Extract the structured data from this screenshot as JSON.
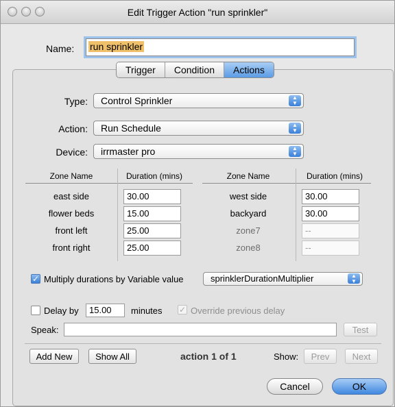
{
  "window": {
    "title": "Edit Trigger Action \"run sprinkler\""
  },
  "name_field": {
    "label": "Name:",
    "value": "run sprinkler"
  },
  "tabs": [
    {
      "label": "Trigger",
      "active": false
    },
    {
      "label": "Condition",
      "active": false
    },
    {
      "label": "Actions",
      "active": true
    }
  ],
  "type_row": {
    "label": "Type:",
    "value": "Control Sprinkler"
  },
  "action_row": {
    "label": "Action:",
    "value": "Run Schedule"
  },
  "device_row": {
    "label": "Device:",
    "value": "irrmaster pro"
  },
  "zones": {
    "headers": {
      "zone_name": "Zone Name",
      "duration": "Duration (mins)"
    },
    "left": [
      {
        "name": "east side",
        "duration": "30.00",
        "enabled": true
      },
      {
        "name": "flower beds",
        "duration": "15.00",
        "enabled": true
      },
      {
        "name": "front left",
        "duration": "25.00",
        "enabled": true
      },
      {
        "name": "front right",
        "duration": "25.00",
        "enabled": true
      }
    ],
    "right": [
      {
        "name": "west side",
        "duration": "30.00",
        "enabled": true
      },
      {
        "name": "backyard",
        "duration": "30.00",
        "enabled": true
      },
      {
        "name": "zone7",
        "duration": "--",
        "enabled": false
      },
      {
        "name": "zone8",
        "duration": "--",
        "enabled": false
      }
    ]
  },
  "multiply": {
    "checked": true,
    "label": "Multiply durations by Variable value",
    "variable": "sprinklerDurationMultiplier"
  },
  "delay": {
    "checked": false,
    "label": "Delay by",
    "value": "15.00",
    "unit": "minutes",
    "override_label": "Override previous delay",
    "override_checked": true
  },
  "speak": {
    "label": "Speak:",
    "value": "",
    "test_label": "Test"
  },
  "footer": {
    "add_new": "Add New",
    "show_all": "Show All",
    "status": "action 1 of 1",
    "show_label": "Show:",
    "prev": "Prev",
    "next": "Next"
  },
  "buttons": {
    "cancel": "Cancel",
    "ok": "OK"
  },
  "icons": {
    "popup": "updown-arrows-icon",
    "check": "checkmark-icon"
  }
}
